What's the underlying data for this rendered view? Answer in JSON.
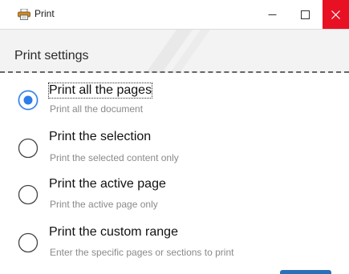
{
  "window": {
    "title": "Print",
    "icon": "printer-icon",
    "controls": {
      "minimize_icon": "minimize-icon",
      "maximize_icon": "maximize-icon",
      "close_icon": "close-icon",
      "close_color": "#e81123"
    }
  },
  "settings": {
    "title": "Print settings"
  },
  "options": [
    {
      "label": "Print all the pages",
      "description": "Print all the document",
      "selected": true
    },
    {
      "label": "Print the selection",
      "description": "Print the selected content only",
      "selected": false
    },
    {
      "label": "Print the active page",
      "description": "Print the active page only",
      "selected": false
    },
    {
      "label": "Print the custom range",
      "description": "Enter the specific pages or sections to print",
      "selected": false
    }
  ],
  "colors": {
    "accent": "#2b7de9",
    "primary_button": "#2b6fb8"
  }
}
